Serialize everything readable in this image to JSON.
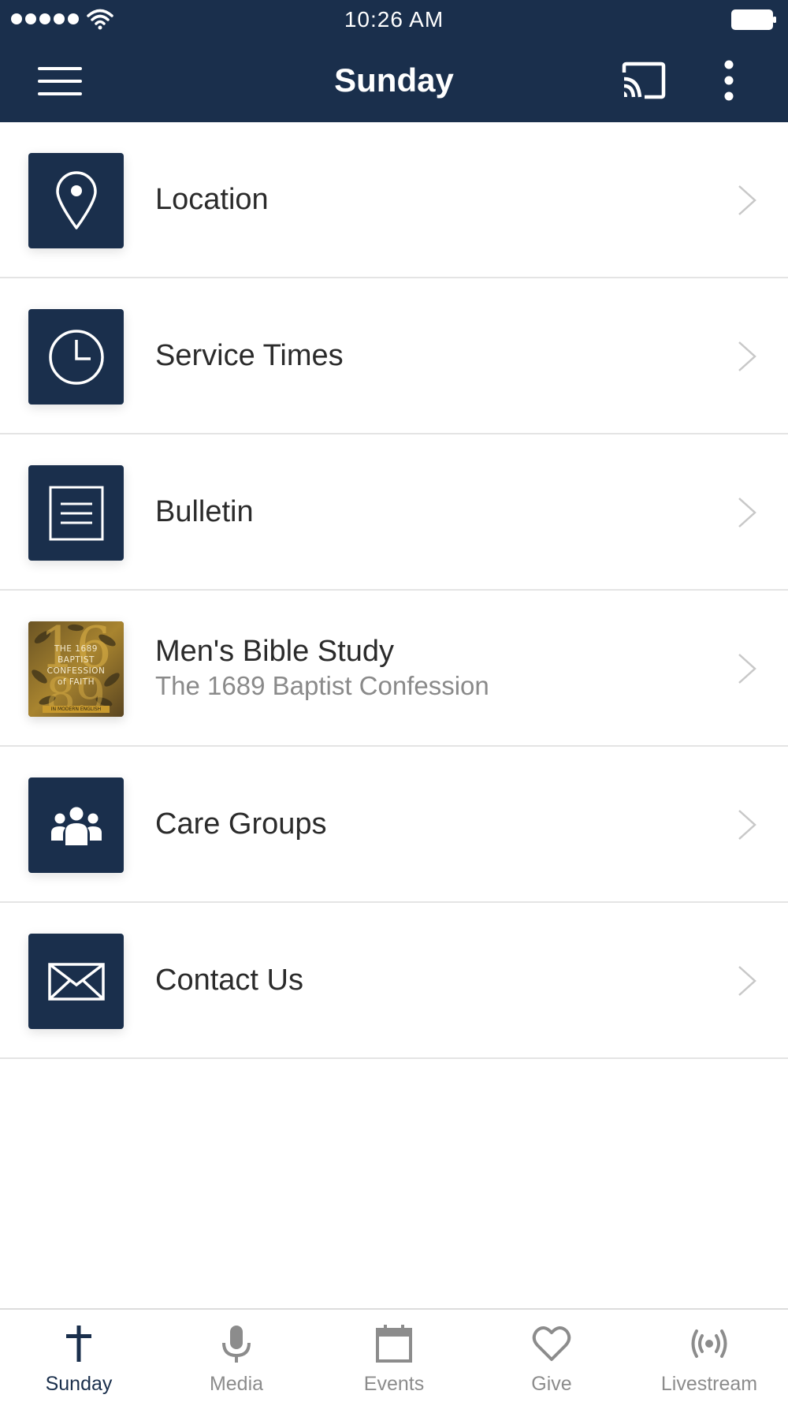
{
  "status_bar": {
    "time": "10:26 AM"
  },
  "nav": {
    "title": "Sunday"
  },
  "list": {
    "items": [
      {
        "title": "Location",
        "subtitle": "",
        "icon": "map-pin-icon"
      },
      {
        "title": "Service Times",
        "subtitle": "",
        "icon": "clock-icon"
      },
      {
        "title": "Bulletin",
        "subtitle": "",
        "icon": "document-icon"
      },
      {
        "title": "Men's Bible Study",
        "subtitle": "The 1689 Baptist Confession",
        "icon": "book-cover-image",
        "cover": {
          "line1": "THE 1689",
          "line2": "BAPTIST",
          "line3": "CONFESSION",
          "line4": "of FAITH",
          "band": "IN MODERN ENGLISH"
        }
      },
      {
        "title": "Care Groups",
        "subtitle": "",
        "icon": "people-group-icon"
      },
      {
        "title": "Contact Us",
        "subtitle": "",
        "icon": "envelope-icon"
      }
    ]
  },
  "tabs": [
    {
      "label": "Sunday",
      "icon": "cross-icon",
      "active": true
    },
    {
      "label": "Media",
      "icon": "microphone-icon",
      "active": false
    },
    {
      "label": "Events",
      "icon": "calendar-icon",
      "active": false
    },
    {
      "label": "Give",
      "icon": "heart-icon",
      "active": false
    },
    {
      "label": "Livestream",
      "icon": "broadcast-icon",
      "active": false
    }
  ],
  "colors": {
    "brand_navy": "#1a2f4c",
    "divider": "#e4e4e4",
    "inactive_tab": "#8c8c8c",
    "chevron": "#c8c8c8"
  }
}
